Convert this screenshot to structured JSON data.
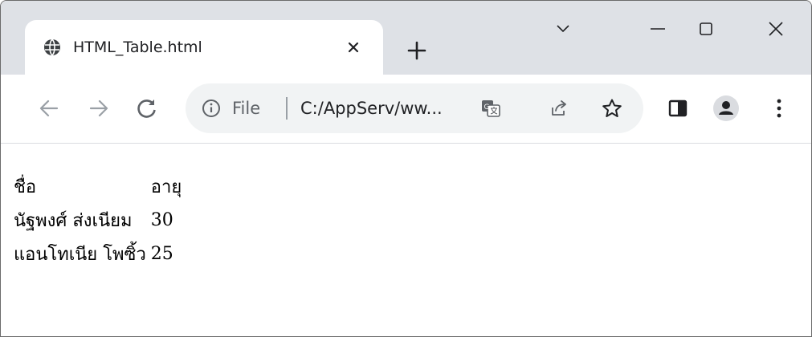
{
  "browser": {
    "tab": {
      "title": "HTML_Table.html",
      "favicon": "globe-icon"
    },
    "window_controls": [
      "chevron-down-icon",
      "minimize-icon",
      "maximize-icon",
      "close-icon"
    ],
    "toolbar": {
      "back_icon": "arrow-left-icon",
      "forward_icon": "arrow-right-icon",
      "reload_icon": "reload-icon",
      "site_info_label": "File",
      "url": "C:/AppServ/ww...",
      "omnibox_icons": [
        "translate-icon",
        "share-icon",
        "star-icon"
      ],
      "right_icons": [
        "side-panel-icon",
        "profile-icon",
        "more-icon"
      ]
    }
  },
  "page": {
    "table": {
      "headers": [
        "ชื่อ",
        "อายุ"
      ],
      "rows": [
        [
          "นัฐพงศ์ ส่งเนียม",
          "30"
        ],
        [
          "แอนโทเนีย โพซิ้ว",
          "25"
        ]
      ]
    }
  },
  "colors": {
    "tabstrip": "#dee1e6",
    "omnibox": "#f1f3f4",
    "icon": "#5f6368",
    "text": "#202124"
  }
}
